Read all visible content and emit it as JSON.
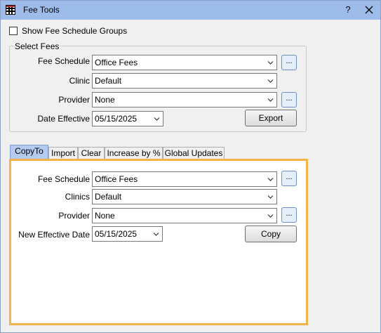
{
  "window": {
    "title": "Fee Tools",
    "help": "?"
  },
  "show_groups": {
    "label": "Show Fee Schedule Groups",
    "checked": false
  },
  "select_fees": {
    "title": "Select Fees",
    "fee_schedule_label": "Fee Schedule",
    "fee_schedule_value": "Office Fees",
    "clinic_label": "Clinic",
    "clinic_value": "Default",
    "provider_label": "Provider",
    "provider_value": "None",
    "date_label": "Date Effective",
    "date_value": "05/15/2025",
    "export_label": "Export",
    "dots": "..."
  },
  "tabs": [
    {
      "label": "CopyTo",
      "active": true
    },
    {
      "label": "Import"
    },
    {
      "label": "Clear"
    },
    {
      "label": "Increase by %"
    },
    {
      "label": "Global Updates"
    }
  ],
  "copyto": {
    "fee_schedule_label": "Fee Schedule",
    "fee_schedule_value": "Office Fees",
    "clinics_label": "Clinics",
    "clinics_value": "Default",
    "provider_label": "Provider",
    "provider_value": "None",
    "date_label": "New Effective Date",
    "date_value": "05/15/2025",
    "copy_label": "Copy",
    "dots": "..."
  },
  "colors": {
    "titlebar": "#9dbcea",
    "tab_highlight": "#f4b24a",
    "active_tab": "#b4cbef"
  }
}
